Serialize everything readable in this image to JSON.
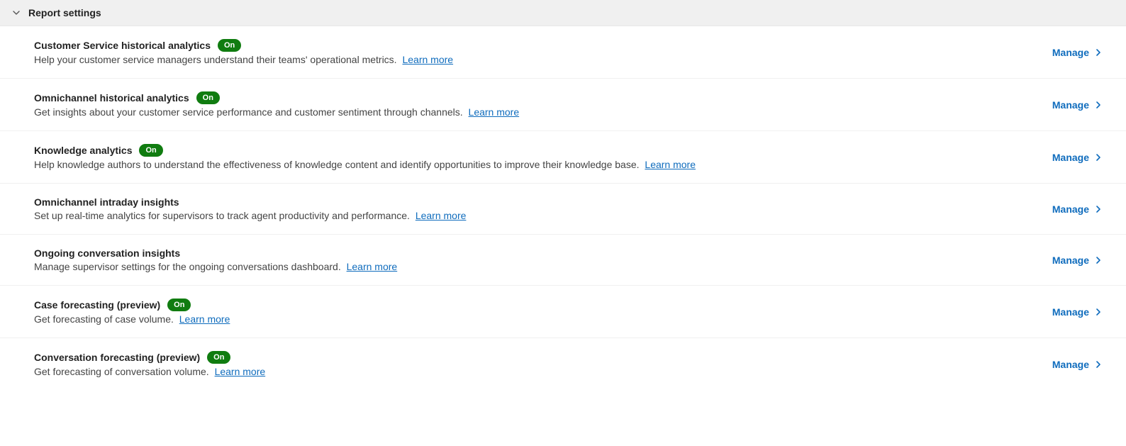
{
  "section": {
    "title": "Report settings"
  },
  "common": {
    "manage_label": "Manage",
    "learn_more_label": "Learn more",
    "on_label": "On"
  },
  "rows": [
    {
      "title": "Customer Service historical analytics",
      "has_badge": true,
      "description": "Help your customer service managers understand their teams' operational metrics."
    },
    {
      "title": "Omnichannel historical analytics",
      "has_badge": true,
      "description": "Get insights about your customer service performance and customer sentiment through channels."
    },
    {
      "title": "Knowledge analytics",
      "has_badge": true,
      "description": "Help knowledge authors to understand the effectiveness of knowledge content and identify opportunities to improve their knowledge base."
    },
    {
      "title": "Omnichannel intraday insights",
      "has_badge": false,
      "description": "Set up real-time analytics for supervisors to track agent productivity and performance."
    },
    {
      "title": "Ongoing conversation insights",
      "has_badge": false,
      "description": "Manage supervisor settings for the ongoing conversations dashboard."
    },
    {
      "title": "Case forecasting (preview)",
      "has_badge": true,
      "description": "Get forecasting of case volume."
    },
    {
      "title": "Conversation forecasting (preview)",
      "has_badge": true,
      "description": "Get forecasting of conversation volume."
    }
  ]
}
